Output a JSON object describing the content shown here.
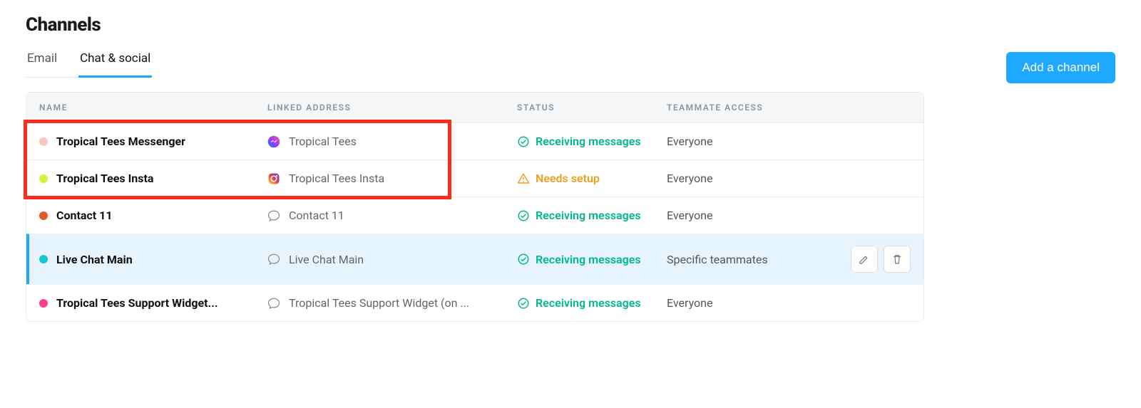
{
  "header": {
    "title": "Channels"
  },
  "tabs": {
    "email": "Email",
    "chat": "Chat & social",
    "active": "chat"
  },
  "actions": {
    "add_channel": "Add a channel"
  },
  "columns": {
    "name": "NAME",
    "linked": "LINKED ADDRESS",
    "status": "STATUS",
    "access": "TEAMMATE ACCESS"
  },
  "statuses": {
    "receiving": "Receiving messages",
    "needs_setup": "Needs setup"
  },
  "rows": [
    {
      "dot_color": "#f7c7c0",
      "name": "Tropical Tees Messenger",
      "icon": "messenger",
      "linked": "Tropical Tees",
      "status": "receiving",
      "access": "Everyone",
      "selected": false,
      "highlighted": true
    },
    {
      "dot_color": "#d7f23a",
      "name": "Tropical Tees Insta",
      "icon": "instagram",
      "linked": "Tropical Tees Insta",
      "status": "needs_setup",
      "access": "Everyone",
      "selected": false,
      "highlighted": true
    },
    {
      "dot_color": "#e25a2b",
      "name": "Contact 11",
      "icon": "chat",
      "linked": "Contact 11",
      "status": "receiving",
      "access": "Everyone",
      "selected": false,
      "highlighted": false
    },
    {
      "dot_color": "#17c6d6",
      "name": "Live Chat Main",
      "icon": "chat",
      "linked": "Live Chat Main",
      "status": "receiving",
      "access": "Specific teammates",
      "selected": true,
      "highlighted": false
    },
    {
      "dot_color": "#ff3d8a",
      "name": "Tropical Tees Support Widget...",
      "icon": "chat",
      "linked": "Tropical Tees Support Widget (on ...",
      "status": "receiving",
      "access": "Everyone",
      "selected": false,
      "highlighted": false
    }
  ],
  "annotation": {
    "highlight_first_two_rows": true
  }
}
